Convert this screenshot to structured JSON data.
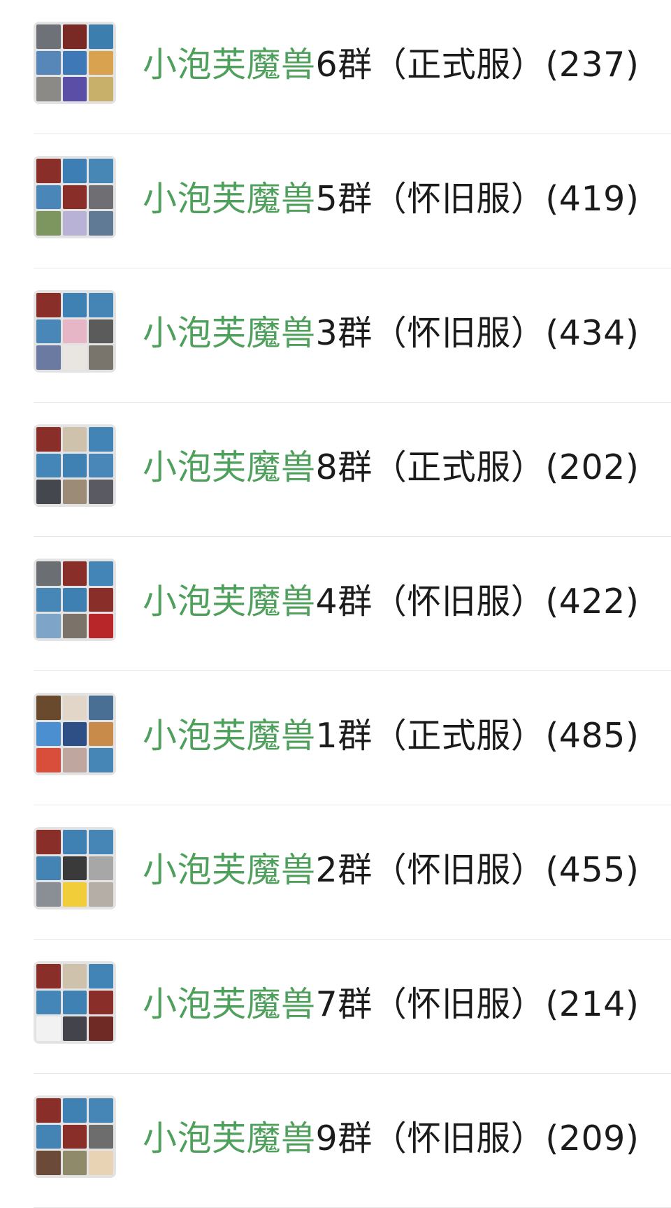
{
  "highlight_color": "#4fa05c",
  "text_color": "#1b1b1b",
  "groups": [
    {
      "keyword": "小泡芙魔兽",
      "rest": "6群（正式服）(237)",
      "avatar_tiles": [
        "#6e7178",
        "#7a2a25",
        "#3c7fae",
        "#5687b8",
        "#3f78b6",
        "#d8a24f",
        "#8b8a86",
        "#5b4ea6",
        "#c9b06a"
      ]
    },
    {
      "keyword": "小泡芙魔兽",
      "rest": "5群（怀旧服）(419)",
      "avatar_tiles": [
        "#8a2e2a",
        "#3d7fb4",
        "#4787b5",
        "#4a86b8",
        "#8a2e2a",
        "#6f6f73",
        "#7d9660",
        "#b8b2d6",
        "#607a95"
      ]
    },
    {
      "keyword": "小泡芙魔兽",
      "rest": "3群（怀旧服）(434)",
      "avatar_tiles": [
        "#8a2e2a",
        "#3f81b3",
        "#4585b6",
        "#4887b7",
        "#e6b6c7",
        "#5b5b5b",
        "#6a7aa0",
        "#e9e5e0",
        "#7a756c"
      ]
    },
    {
      "keyword": "小泡芙魔兽",
      "rest": "8群（正式服）(202)",
      "avatar_tiles": [
        "#8a2e2a",
        "#cfc2ad",
        "#4284b6",
        "#4486b7",
        "#3f81b2",
        "#4887b7",
        "#45474e",
        "#9b8b77",
        "#5a5a62"
      ]
    },
    {
      "keyword": "小泡芙魔兽",
      "rest": "4群（怀旧服）(422)",
      "avatar_tiles": [
        "#6b6e73",
        "#8a2e2a",
        "#4385b6",
        "#4787b7",
        "#3f80b2",
        "#8a2e2a",
        "#7ea4c7",
        "#7b736a",
        "#b8262a"
      ]
    },
    {
      "keyword": "小泡芙魔兽",
      "rest": "1群（正式服）(485)",
      "avatar_tiles": [
        "#6a4a2c",
        "#e2d6c8",
        "#4a6f95",
        "#4c8fd0",
        "#2e4f86",
        "#c98b4a",
        "#d94d3b",
        "#bfa7a0",
        "#4686b6"
      ]
    },
    {
      "keyword": "小泡芙魔兽",
      "rest": "2群（怀旧服）(455)",
      "avatar_tiles": [
        "#8a2e2a",
        "#3f81b3",
        "#4686b6",
        "#4484b5",
        "#3a3a3a",
        "#a7a7a7",
        "#8a8f95",
        "#f2cd3a",
        "#b5aea6"
      ]
    },
    {
      "keyword": "小泡芙魔兽",
      "rest": "7群（怀旧服）(214)",
      "avatar_tiles": [
        "#8a2e2a",
        "#cfc2ad",
        "#4284b6",
        "#4486b7",
        "#3f81b2",
        "#8a2e2a",
        "#f2f2f2",
        "#43444b",
        "#6f2a26"
      ]
    },
    {
      "keyword": "小泡芙魔兽",
      "rest": "9群（怀旧服）(209)",
      "avatar_tiles": [
        "#8a2e2a",
        "#3f81b3",
        "#4686b6",
        "#4484b5",
        "#8a2e2a",
        "#6d6d6d",
        "#6b4a3a",
        "#8e8a6a",
        "#e8d3b5"
      ]
    }
  ]
}
